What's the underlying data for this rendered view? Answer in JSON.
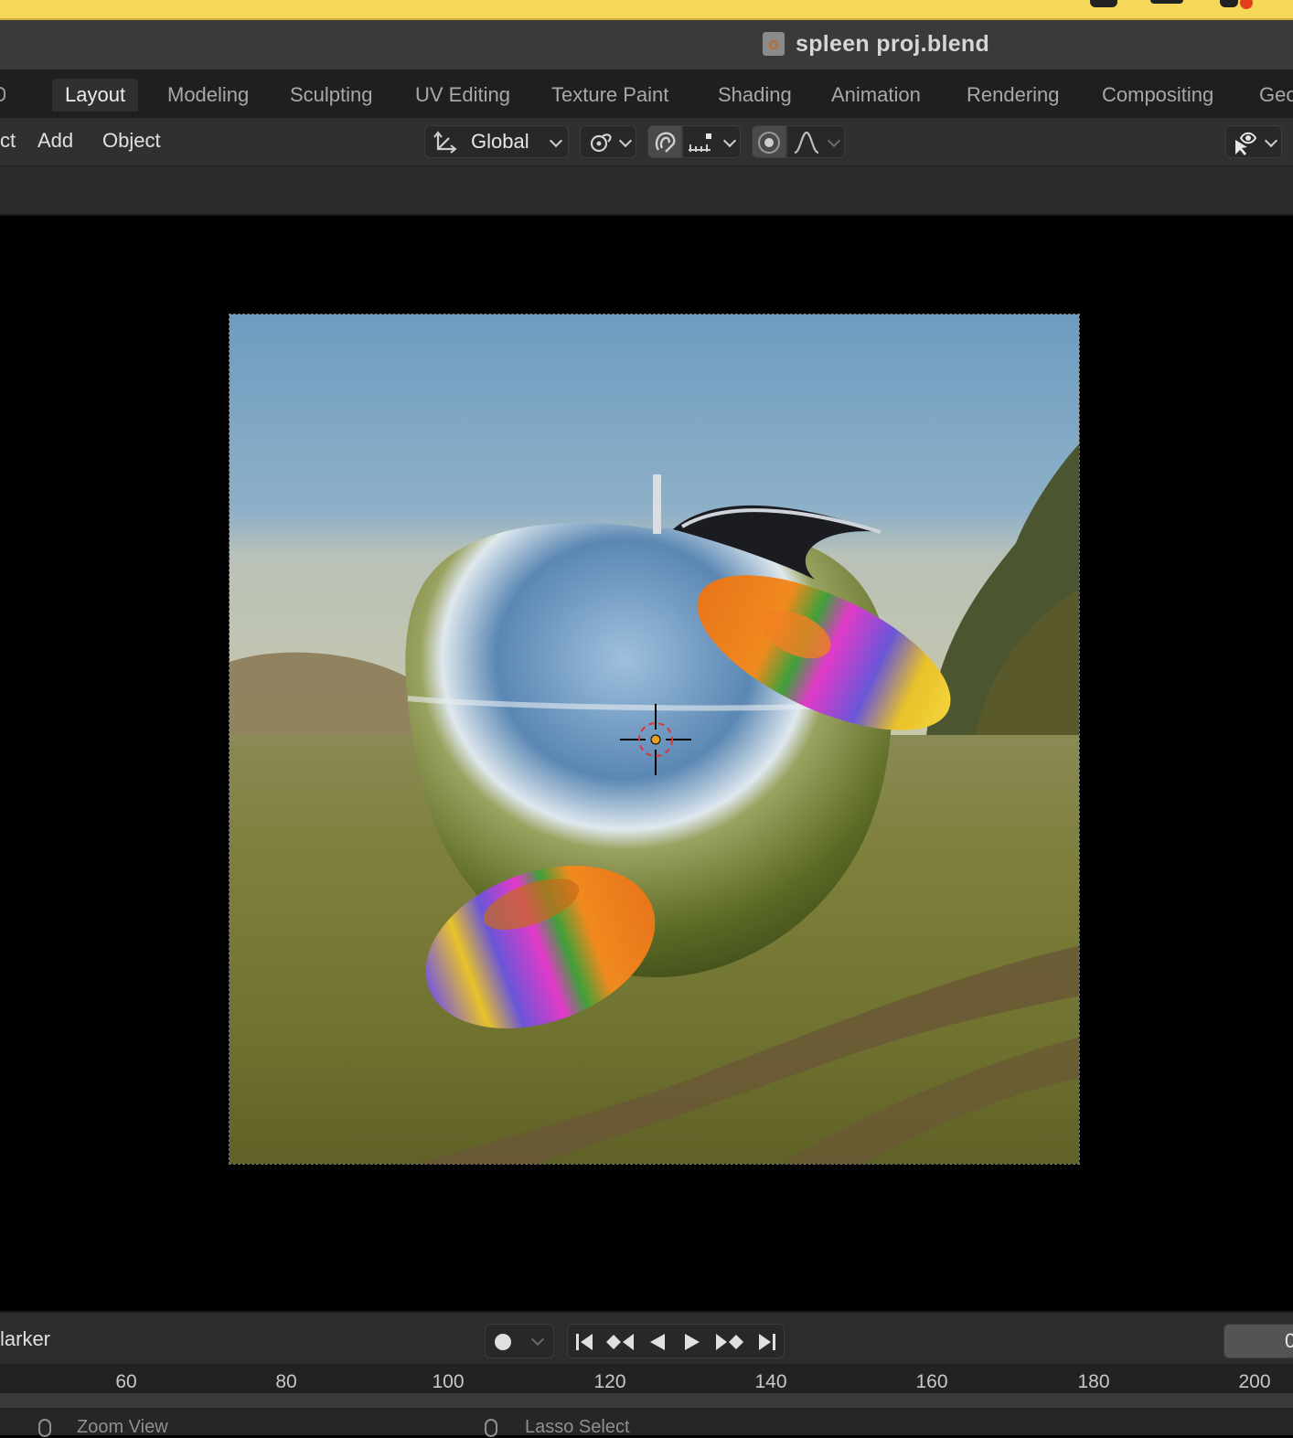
{
  "window": {
    "title": "spleen proj.blend"
  },
  "workspace_tabs": [
    {
      "label": "Layout",
      "active": true
    },
    {
      "label": "Modeling"
    },
    {
      "label": "Sculpting"
    },
    {
      "label": "UV Editing"
    },
    {
      "label": "Texture Paint"
    },
    {
      "label": "Shading"
    },
    {
      "label": "Animation"
    },
    {
      "label": "Rendering"
    },
    {
      "label": "Compositing"
    },
    {
      "label": "Geo"
    }
  ],
  "header": {
    "menu_partial_left": "ct",
    "menu_add": "Add",
    "menu_object": "Object",
    "transform_orientation": "Global",
    "pivot_icon": "transform-orientation-icon",
    "snap_icon": "snap-magnet-icon",
    "proportional_icon": "proportional-editing-icon",
    "visibility_icon": "selectability-visibility-icon"
  },
  "viewport": {
    "content": "rendered camera view",
    "cursor_icon": "3d-cursor-icon"
  },
  "timeline": {
    "marker_label": "larker",
    "frame_labels": [
      "60",
      "80",
      "100",
      "120",
      "140",
      "160",
      "180",
      "200"
    ],
    "current_frame_partial": "0",
    "playback_buttons": [
      "jump-start",
      "prev-keyframe",
      "play-reverse",
      "play",
      "next-keyframe",
      "jump-end"
    ]
  },
  "statusbar": {
    "left_hint": "Zoom View",
    "mid_hint": "Lasso Select"
  },
  "colors": {
    "mac_menubar": "#f7d75a",
    "tab_bg": "#1f1f1f",
    "active_tab": "#303030",
    "cursor_orange": "#e8a020"
  }
}
